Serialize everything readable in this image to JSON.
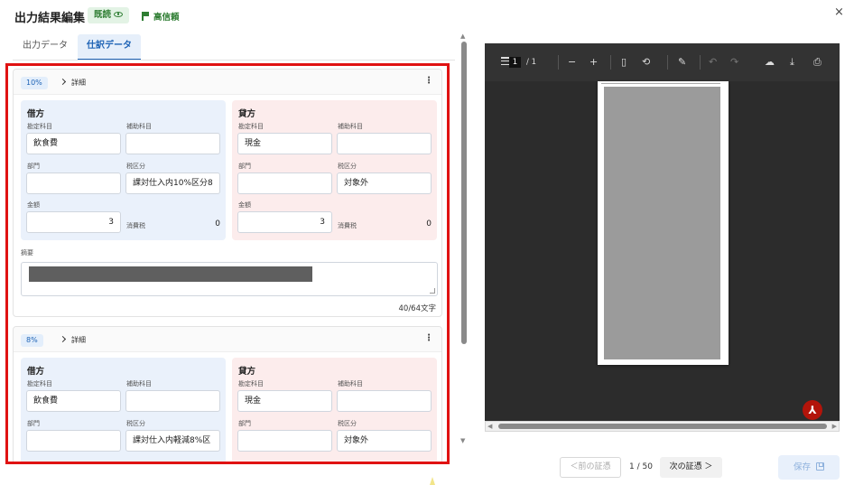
{
  "header": {
    "title": "出力結果編集",
    "read_badge": "既読",
    "confidence": "高信頼",
    "close_glyph": "×"
  },
  "tabs": [
    {
      "label": "出力データ",
      "active": false
    },
    {
      "label": "仕訳データ",
      "active": true
    }
  ],
  "entries": [
    {
      "rate": "10%",
      "detail_label": "詳細",
      "debit": {
        "heading": "借方",
        "account_label": "勘定科目",
        "account": "飲食費",
        "sub_account_label": "補助科目",
        "sub_account": "",
        "dept_label": "部門",
        "dept": "",
        "tax_class_label": "税区分",
        "tax_class": "課対仕入内10%区分8",
        "amount_label": "金額",
        "amount": "3",
        "tax_label": "消費税",
        "tax": "0"
      },
      "credit": {
        "heading": "貸方",
        "account_label": "勘定科目",
        "account": "現金",
        "sub_account_label": "補助科目",
        "sub_account": "",
        "dept_label": "部門",
        "dept": "",
        "tax_class_label": "税区分",
        "tax_class": "対象外",
        "amount_label": "金額",
        "amount": "3",
        "tax_label": "消費税",
        "tax": "0"
      },
      "memo_label": "摘要",
      "memo_counter": "40/64文字"
    },
    {
      "rate": "8%",
      "detail_label": "詳細",
      "debit": {
        "heading": "借方",
        "account_label": "勘定科目",
        "account": "飲食費",
        "sub_account_label": "補助科目",
        "sub_account": "",
        "dept_label": "部門",
        "dept": "",
        "tax_class_label": "税区分",
        "tax_class": "課対仕入内軽減8%区"
      },
      "credit": {
        "heading": "貸方",
        "account_label": "勘定科目",
        "account": "現金",
        "sub_account_label": "補助科目",
        "sub_account": "",
        "dept_label": "部門",
        "dept": "",
        "tax_class_label": "税区分",
        "tax_class": "対象外"
      }
    }
  ],
  "pdf_viewer": {
    "current_page": "1",
    "total_pages": "/ 1",
    "toolbar": {
      "zoom_out": "−",
      "zoom_in": "+",
      "undo": "↶",
      "redo": "↷",
      "download": "⤓",
      "print": "⎙"
    },
    "acrobat_glyph": "⅄"
  },
  "footer": {
    "prev_label": "＜前の証憑",
    "page_indicator": "1 / 50",
    "next_label": "次の証憑 ＞",
    "save_label": "保存"
  },
  "colors": {
    "accent": "#1e63b5",
    "success": "#2e7d32",
    "highlight_border": "#e01212",
    "debit_bg": "#eaf1fb",
    "credit_bg": "#fcecec"
  }
}
